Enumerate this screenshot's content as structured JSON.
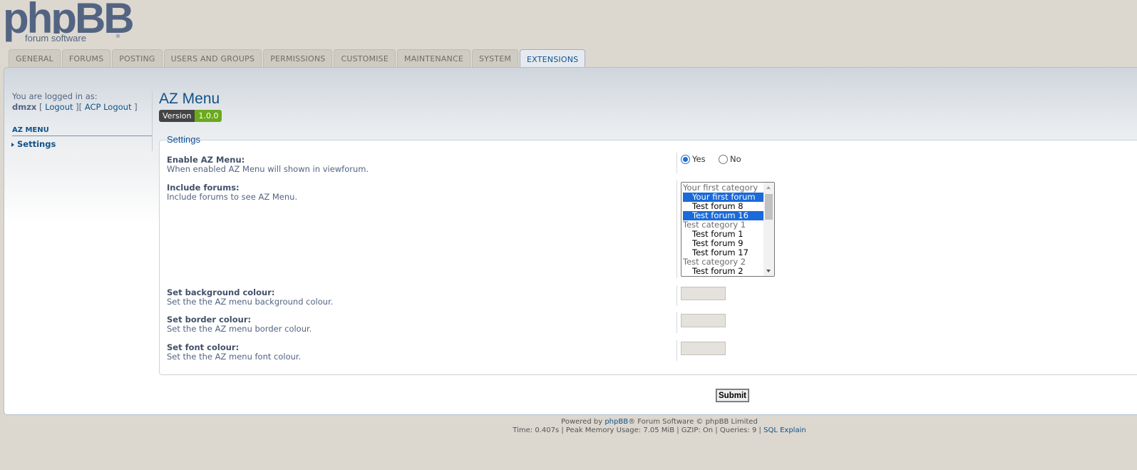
{
  "logo": {
    "main": "phpBB",
    "sub": "forum software",
    "reg": "®"
  },
  "tabs": [
    "GENERAL",
    "FORUMS",
    "POSTING",
    "USERS AND GROUPS",
    "PERMISSIONS",
    "CUSTOMISE",
    "MAINTENANCE",
    "SYSTEM",
    "EXTENSIONS"
  ],
  "sidebar": {
    "logged_in_label": "You are logged in as:",
    "username": "dmzx",
    "logout": "Logout",
    "acp_logout": "ACP Logout",
    "section": "AZ MENU",
    "item": "Settings"
  },
  "main": {
    "title": "AZ Menu",
    "version_label": "Version",
    "version_value": "1.0.0",
    "legend": "Settings",
    "enable": {
      "label": "Enable AZ Menu:",
      "desc": "When enabled AZ Menu will shown in viewforum.",
      "yes": "Yes",
      "no": "No",
      "selected": "Yes"
    },
    "include": {
      "label": "Include forums:",
      "desc": "Include forums to see AZ Menu.",
      "options": [
        {
          "type": "group",
          "text": "Your first category"
        },
        {
          "type": "option",
          "text": "Your first forum",
          "selected": true
        },
        {
          "type": "option",
          "text": "Test forum 8",
          "selected": false
        },
        {
          "type": "option",
          "text": "Test forum 16",
          "selected": true
        },
        {
          "type": "group",
          "text": "Test category 1"
        },
        {
          "type": "option",
          "text": "Test forum 1",
          "selected": false
        },
        {
          "type": "option",
          "text": "Test forum 9",
          "selected": false
        },
        {
          "type": "option",
          "text": "Test forum 17",
          "selected": false
        },
        {
          "type": "group",
          "text": "Test category 2"
        },
        {
          "type": "option",
          "text": "Test forum 2",
          "selected": false
        }
      ]
    },
    "bg_colour": {
      "label": "Set background colour:",
      "desc": "Set the the AZ menu background colour."
    },
    "border_colour": {
      "label": "Set border colour:",
      "desc": "Set the the AZ menu border colour."
    },
    "font_colour": {
      "label": "Set font colour:",
      "desc": "Set the the AZ menu font colour."
    },
    "submit": "Submit"
  },
  "footer": {
    "powered_prefix": "Powered by ",
    "powered_link": "phpBB",
    "powered_suffix": "® Forum Software © phpBB Limited",
    "stats": "Time: 0.407s | Peak Memory Usage: 7.05 MiB | GZIP: On | Queries: 9 | ",
    "sql_link": "SQL Explain"
  }
}
